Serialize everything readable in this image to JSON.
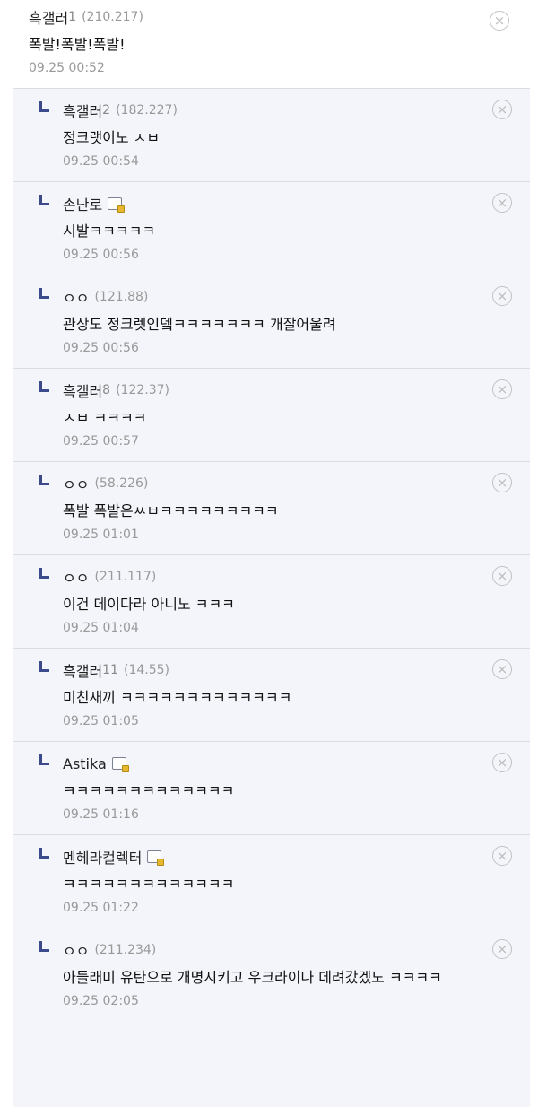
{
  "comments": [
    {
      "nick": "흑갤러",
      "num": "1",
      "ip": "(210.217)",
      "text": "폭발!폭발!폭발!",
      "date": "09.25 00:52",
      "badge": false
    },
    {
      "nick": "흑갤러",
      "num": "2",
      "ip": "(182.227)",
      "text": "정크랫이노 ㅅㅂ",
      "date": "09.25 00:54",
      "badge": false
    },
    {
      "nick": "손난로",
      "num": "",
      "ip": "",
      "text": "시발ㅋㅋㅋㅋㅋ",
      "date": "09.25 00:56",
      "badge": true
    },
    {
      "nick": "ㅇㅇ",
      "num": "",
      "ip": "(121.88)",
      "text": "관상도 정크렛인뎈ㅋㅋㅋㅋㅋㅋㅋ 개잘어울려",
      "date": "09.25 00:56",
      "badge": false
    },
    {
      "nick": "흑갤러",
      "num": "8",
      "ip": "(122.37)",
      "text": "ㅅㅂ ㅋㅋㅋㅋ",
      "date": "09.25 00:57",
      "badge": false
    },
    {
      "nick": "ㅇㅇ",
      "num": "",
      "ip": "(58.226)",
      "text": "폭발 폭발은ㅆㅂㅋㅋㅋㅋㅋㅋㅋㅋㅋ",
      "date": "09.25 01:01",
      "badge": false
    },
    {
      "nick": "ㅇㅇ",
      "num": "",
      "ip": "(211.117)",
      "text": "이건 데이다라 아니노 ㅋㅋㅋ",
      "date": "09.25 01:04",
      "badge": false
    },
    {
      "nick": "흑갤러",
      "num": "11",
      "ip": "(14.55)",
      "text": "미친새끼 ㅋㅋㅋㅋㅋㅋㅋㅋㅋㅋㅋㅋㅋ",
      "date": "09.25 01:05",
      "badge": false
    },
    {
      "nick": "Astika",
      "num": "",
      "ip": "",
      "text": "ㅋㅋㅋㅋㅋㅋㅋㅋㅋㅋㅋㅋㅋ",
      "date": "09.25 01:16",
      "badge": true
    },
    {
      "nick": "멘헤라컬렉터",
      "num": "",
      "ip": "",
      "text": "ㅋㅋㅋㅋㅋㅋㅋㅋㅋㅋㅋㅋㅋ",
      "date": "09.25 01:22",
      "badge": true
    },
    {
      "nick": "ㅇㅇ",
      "num": "",
      "ip": "(211.234)",
      "text": "아들래미 유탄으로 개명시키고 우크라이나 데려갔겠노 ㅋㅋㅋㅋ",
      "date": "09.25 02:05",
      "badge": false
    }
  ],
  "icons": {
    "reply": "reply-arrow-icon",
    "delete": "circle-x-icon",
    "badge": "fixed-nick-badge-icon"
  },
  "colors": {
    "reply_bg": "#f3f5fa",
    "arrow": "#3a4a8a",
    "meta": "#999999"
  }
}
